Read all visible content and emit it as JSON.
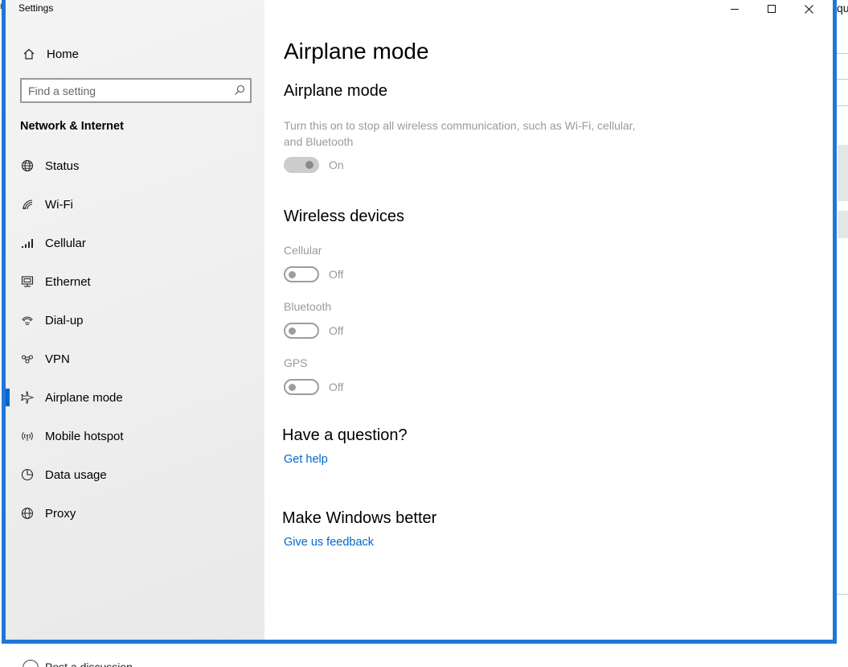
{
  "window": {
    "title": "Settings"
  },
  "background": {
    "right_fragment": "qu",
    "bottom_fragment": "Post a discussion"
  },
  "sidebar": {
    "home_label": "Home",
    "search_placeholder": "Find a setting",
    "section_heading": "Network & Internet",
    "items": [
      {
        "label": "Status",
        "icon": "globe-status-icon"
      },
      {
        "label": "Wi-Fi",
        "icon": "wifi-icon"
      },
      {
        "label": "Cellular",
        "icon": "cellular-signal-icon"
      },
      {
        "label": "Ethernet",
        "icon": "ethernet-icon"
      },
      {
        "label": "Dial-up",
        "icon": "dial-up-phone-icon"
      },
      {
        "label": "VPN",
        "icon": "vpn-icon"
      },
      {
        "label": "Airplane mode",
        "icon": "airplane-icon",
        "active": true
      },
      {
        "label": "Mobile hotspot",
        "icon": "hotspot-icon"
      },
      {
        "label": "Data usage",
        "icon": "data-usage-pie-icon"
      },
      {
        "label": "Proxy",
        "icon": "proxy-globe-icon"
      }
    ]
  },
  "main": {
    "page_title": "Airplane mode",
    "airplane": {
      "heading": "Airplane mode",
      "description": "Turn this on to stop all wireless communication, such as Wi-Fi, cellular, and Bluetooth",
      "state": "On"
    },
    "wireless": {
      "heading": "Wireless devices",
      "devices": [
        {
          "label": "Cellular",
          "state": "Off"
        },
        {
          "label": "Bluetooth",
          "state": "Off"
        },
        {
          "label": "GPS",
          "state": "Off"
        }
      ]
    },
    "question": {
      "heading": "Have a question?",
      "link": "Get help"
    },
    "better": {
      "heading": "Make Windows better",
      "link": "Give us feedback"
    }
  },
  "colors": {
    "accent": "#0066cc",
    "window_border": "#1e78d6",
    "disabled_text": "#9a9a9a"
  }
}
